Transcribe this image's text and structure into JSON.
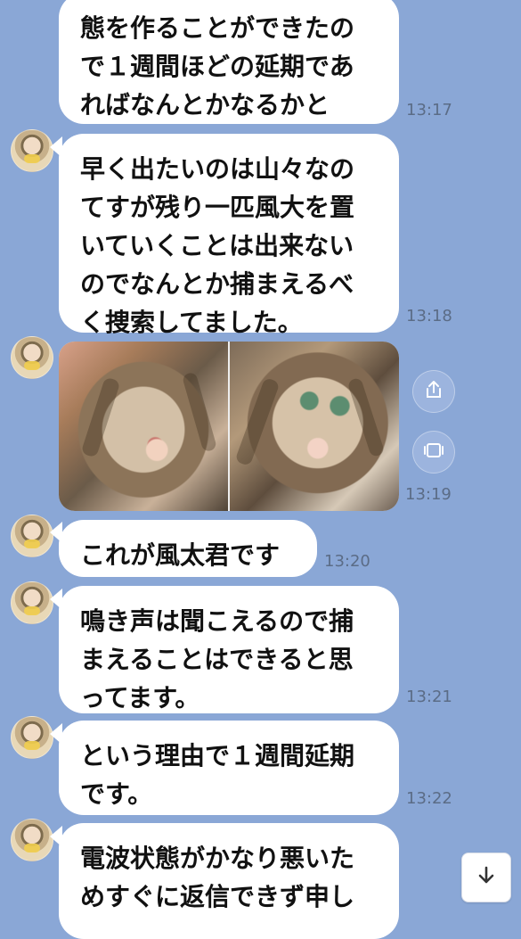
{
  "messages": [
    {
      "text": "態を作ることができたので１週間ほどの延期であればなんとかなるかと",
      "time": "13:17"
    },
    {
      "text": "早く出たいのは山々なのてすが残り一匹風大を置いていくことは出来ないのでなんとか捕まえるべく捜索してました。",
      "time": "13:18"
    },
    {
      "time": "13:19",
      "photos": [
        "cat-photo-1",
        "cat-photo-2"
      ]
    },
    {
      "text": "これが風太君です",
      "time": "13:20"
    },
    {
      "text": "鳴き声は聞こえるので捕まえることはできると思ってます。",
      "time": "13:21"
    },
    {
      "text": "という理由で１週間延期です。",
      "time": "13:22"
    },
    {
      "text": "電波状態がかなり悪いためすぐに返信できず申し"
    }
  ],
  "icons": {
    "share": "share-icon",
    "gallery": "gallery-icon",
    "scroll_down": "arrow-down-icon"
  },
  "colors": {
    "background": "#8aa7d6",
    "bubble": "#ffffff",
    "time": "#5b6c86"
  }
}
